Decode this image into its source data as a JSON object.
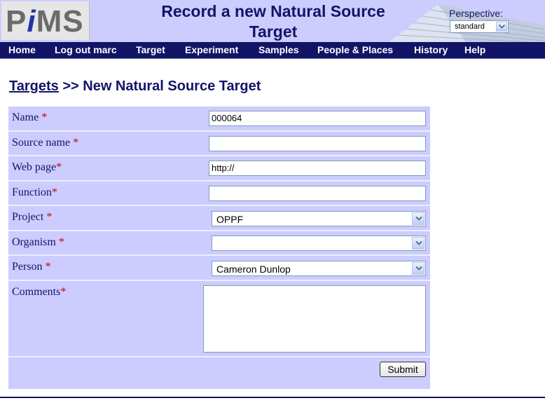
{
  "header": {
    "logo_text_p": "P",
    "logo_text_i": "i",
    "logo_text_ms": "MS",
    "title": "Record a new Natural Source Target",
    "perspective_label": "Perspective:",
    "perspective_value": "standard"
  },
  "nav": {
    "items": [
      "Home",
      "Log out marc",
      "Target",
      "Experiment",
      "Samples",
      "People & Places",
      "History",
      "Help"
    ]
  },
  "breadcrumb": {
    "parent": "Targets",
    "separator": ">>",
    "current": "New Natural Source Target"
  },
  "form": {
    "fields": [
      {
        "label": "Name",
        "value": "000064"
      },
      {
        "label": "Source name",
        "value": ""
      },
      {
        "label": "Web page",
        "value": "http://"
      },
      {
        "label": "Function",
        "value": ""
      },
      {
        "label": "Project",
        "value": "OPPF"
      },
      {
        "label": "Organism",
        "value": ""
      },
      {
        "label": "Person",
        "value": "Cameron Dunlop"
      },
      {
        "label": "Comments",
        "value": ""
      }
    ],
    "required_marker": "*",
    "submit_label": "Submit"
  },
  "colors": {
    "navy": "#121466",
    "lavender": "#ccccff",
    "required": "#cc0000"
  }
}
